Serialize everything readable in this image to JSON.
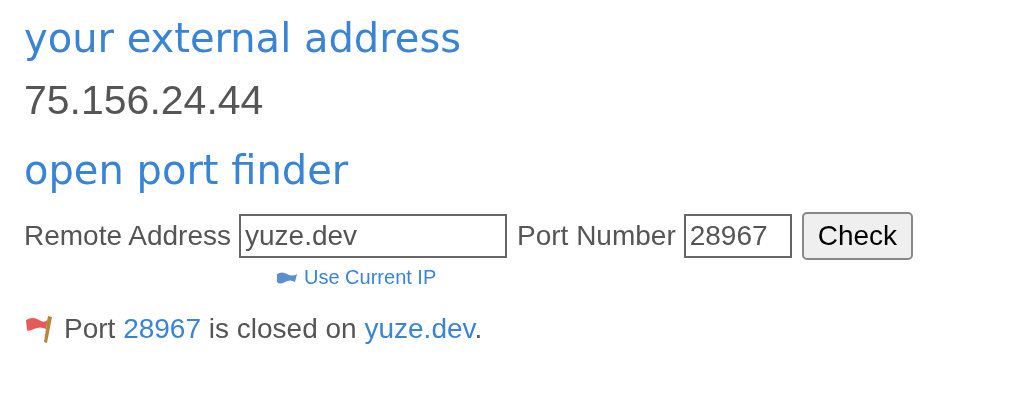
{
  "external": {
    "heading": "your external address",
    "address": "75.156.24.44"
  },
  "finder": {
    "heading": "open port finder",
    "remote_label": "Remote Address",
    "remote_value": "yuze.dev",
    "port_label": "Port Number",
    "port_value": "28967",
    "button": "Check",
    "use_ip_link": "Use Current IP"
  },
  "result": {
    "open": false,
    "before": "Port",
    "port": "28967",
    "middle": "is closed on",
    "host": "yuze.dev",
    "after": "."
  }
}
